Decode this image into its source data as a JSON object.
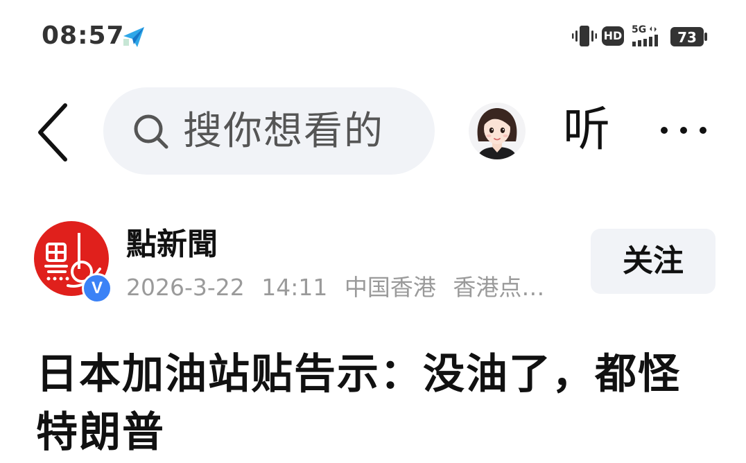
{
  "status_bar": {
    "time": "08:57",
    "hd": "HD",
    "network": "5G",
    "battery": "73"
  },
  "nav": {
    "search_placeholder": "搜你想看的",
    "listen_label": "听"
  },
  "author": {
    "name": "點新聞",
    "date": "2026-3-22",
    "time": "14:11",
    "location": "中国香港",
    "source": "香港点…",
    "verified_label": "V",
    "follow_label": "关注"
  },
  "article": {
    "title": "日本加油站贴告示：没油了，都怪特朗普"
  },
  "colors": {
    "accent_red": "#e0201c",
    "verified_blue": "#3b82f6",
    "search_bg": "#f1f3f7"
  },
  "icons": [
    "send-icon",
    "vibrate-icon",
    "signal-icon",
    "battery-icon",
    "back-icon",
    "search-icon",
    "more-icon"
  ]
}
